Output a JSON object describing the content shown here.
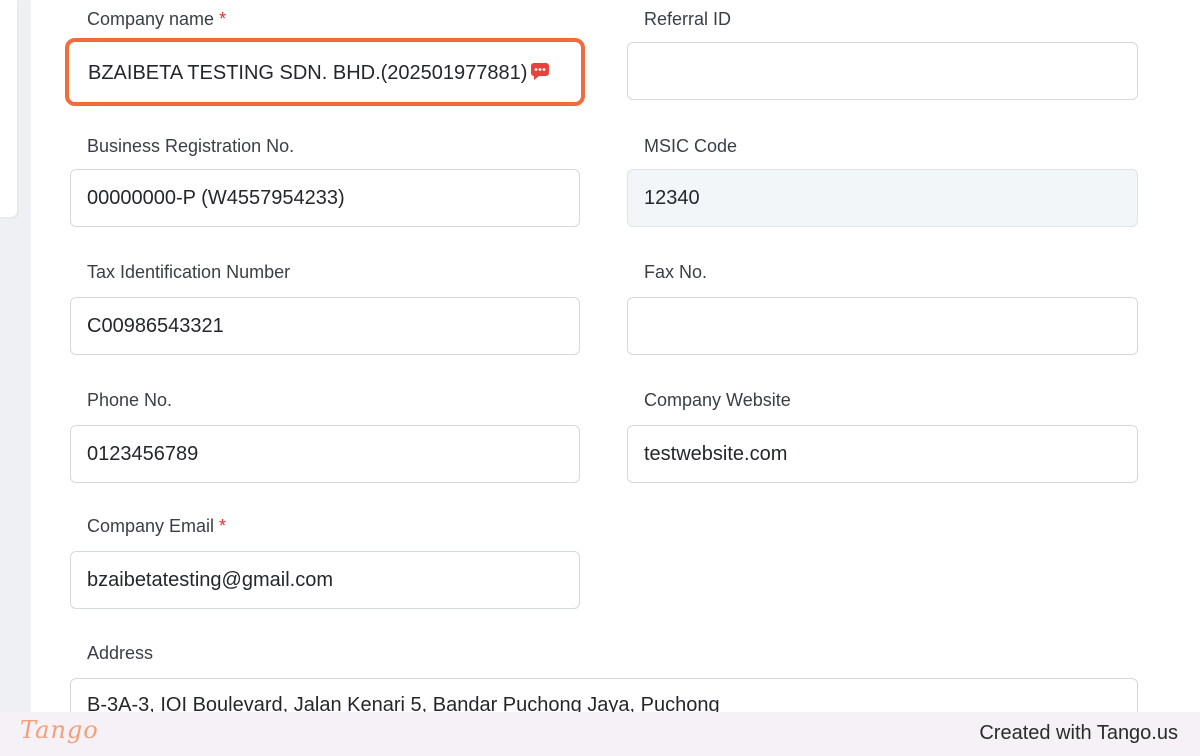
{
  "form": {
    "company_name": {
      "label": "Company name",
      "required_mark": "*",
      "value": "BZAIBETA TESTING SDN. BHD.(202501977881)"
    },
    "referral_id": {
      "label": "Referral ID",
      "value": ""
    },
    "business_registration": {
      "label": "Business Registration No.",
      "value": "00000000-P (W4557954233)"
    },
    "msic_code": {
      "label": "MSIC Code",
      "value": "12340"
    },
    "tax_id": {
      "label": "Tax Identification Number",
      "value": "C00986543321"
    },
    "fax": {
      "label": "Fax No.",
      "value": ""
    },
    "phone": {
      "label": "Phone No.",
      "value": "0123456789"
    },
    "website": {
      "label": "Company Website",
      "value": "testwebsite.com"
    },
    "email": {
      "label": "Company Email",
      "required_mark": "*",
      "value": "bzaibetatesting@gmail.com"
    },
    "address": {
      "label": "Address",
      "value": "B-3A-3, IOI Boulevard, Jalan Kenari 5, Bandar Puchong Jaya, Puchong"
    }
  },
  "icons": {
    "chat": "chat-bubble-icon"
  },
  "colors": {
    "focus_ring": "#f26b3a",
    "required": "#e0322c",
    "chat_icon": "#e8423a"
  },
  "footer": {
    "logo": "Tango",
    "created_with": "Created with Tango.us"
  }
}
